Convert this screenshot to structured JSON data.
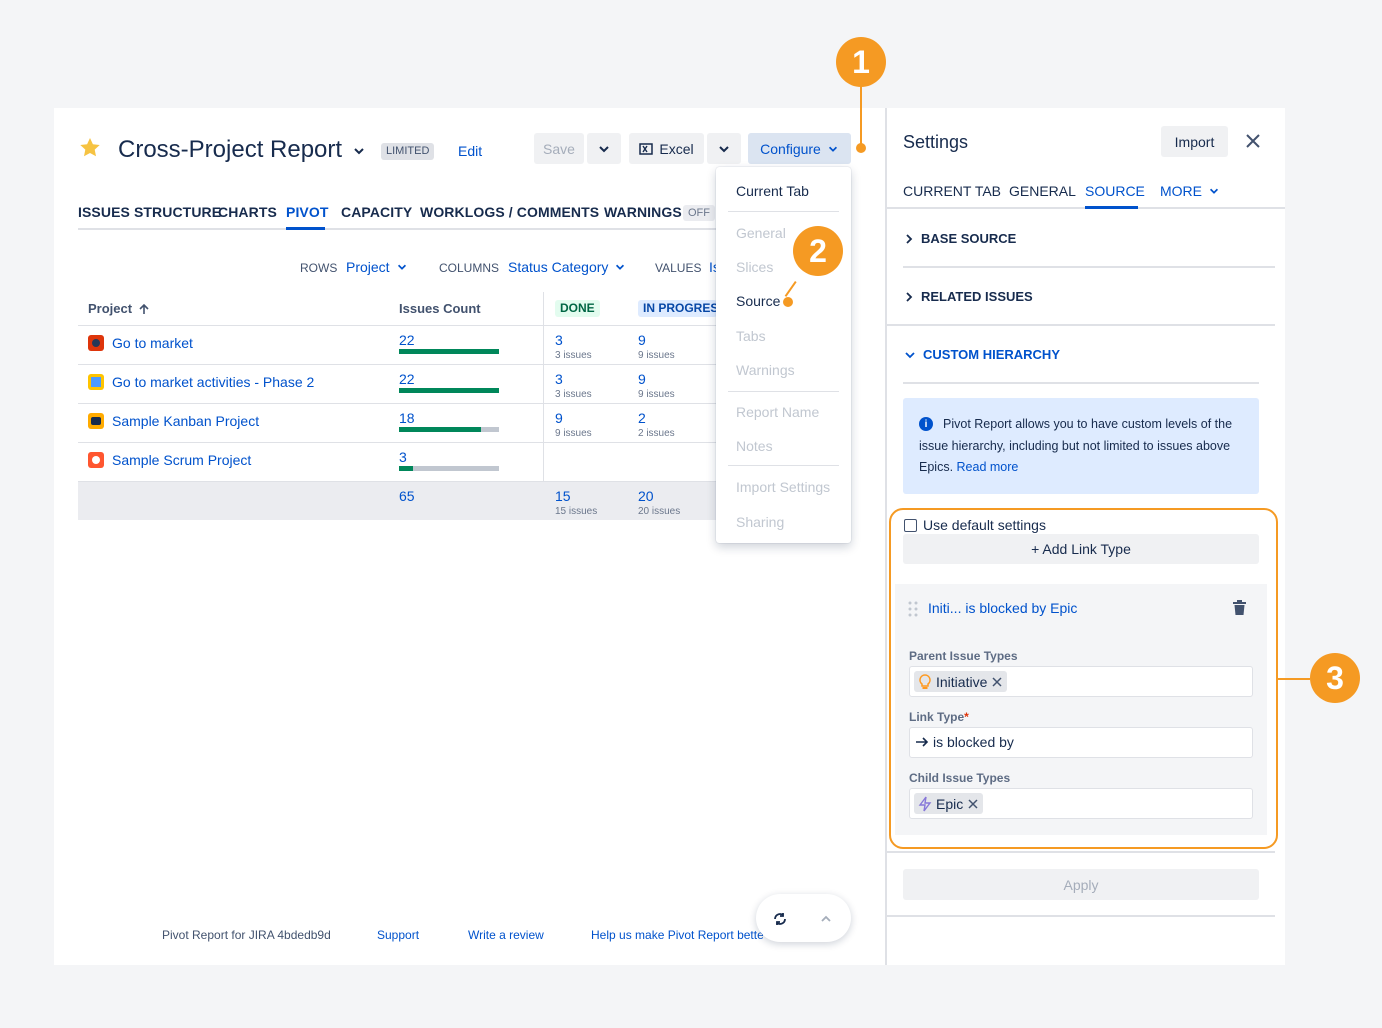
{
  "report": {
    "title": "Cross-Project Report",
    "badge": "LIMITED",
    "edit_label": "Edit"
  },
  "toolbar": {
    "save_label": "Save",
    "excel_label": "Excel",
    "configure_label": "Configure"
  },
  "tabs": [
    "ISSUES STRUCTURE",
    "CHARTS",
    "PIVOT",
    "CAPACITY",
    "WORKLOGS / COMMENTS",
    "WARNINGS"
  ],
  "warnings_badge": "OFF",
  "pivot_controls": {
    "rows_label": "ROWS",
    "rows_value": "Project",
    "columns_label": "COLUMNS",
    "columns_value": "Status Category",
    "values_label": "VALUES",
    "values_value": "Is"
  },
  "table": {
    "col_project": "Project",
    "col_issues_count": "Issues Count",
    "col_done": "DONE",
    "col_in_progress": "IN PROGRESS",
    "rows": [
      {
        "name": "Go to market",
        "count": "22",
        "fill": 1.0,
        "done": "3",
        "done_sub": "3 issues",
        "inprog": "9",
        "inprog_sub": "9 issues"
      },
      {
        "name": "Go to market activities - Phase 2",
        "count": "22",
        "fill": 1.0,
        "done": "3",
        "done_sub": "3 issues",
        "inprog": "9",
        "inprog_sub": "9 issues"
      },
      {
        "name": "Sample Kanban Project",
        "count": "18",
        "fill": 0.82,
        "done": "9",
        "done_sub": "9 issues",
        "inprog": "2",
        "inprog_sub": "2 issues"
      },
      {
        "name": "Sample Scrum Project",
        "count": "3",
        "fill": 0.14,
        "done": "",
        "done_sub": "",
        "inprog": "",
        "inprog_sub": ""
      }
    ],
    "total": {
      "count": "65",
      "done": "15",
      "done_sub": "15 issues",
      "inprog": "20",
      "inprog_sub": "20 issues"
    }
  },
  "configure_menu": {
    "items": [
      "Current Tab",
      "General",
      "Slices",
      "Source",
      "Tabs",
      "Warnings",
      "Report Name",
      "Notes",
      "Import Settings",
      "Sharing"
    ]
  },
  "footer": {
    "version": "Pivot Report for JIRA 4bdedb9d",
    "support": "Support",
    "review": "Write a review",
    "help": "Help us make Pivot Report bette"
  },
  "settings": {
    "title": "Settings",
    "import_label": "Import",
    "tabs": [
      "CURRENT TAB",
      "GENERAL",
      "SOURCE",
      "MORE"
    ],
    "base_source": "BASE SOURCE",
    "related_issues": "RELATED ISSUES",
    "custom_hierarchy": "CUSTOM HIERARCHY",
    "info_text": "Pivot Report allows you to have custom levels of the issue hierarchy, including but not limited to issues above Epics.",
    "read_more": "Read more",
    "use_default": "Use default settings",
    "add_link_type": "+ Add Link Type",
    "link_title": "Initi... is blocked by Epic",
    "parent_label": "Parent Issue Types",
    "parent_value": "Initiative",
    "link_type_label": "Link Type",
    "required_mark": "*",
    "link_type_value": "is blocked by",
    "child_label": "Child Issue Types",
    "child_value": "Epic",
    "apply_label": "Apply"
  },
  "callouts": [
    "1",
    "2",
    "3"
  ],
  "colors": {
    "accent": "#0052cc",
    "callout": "#f59a23",
    "success": "#00875a"
  }
}
